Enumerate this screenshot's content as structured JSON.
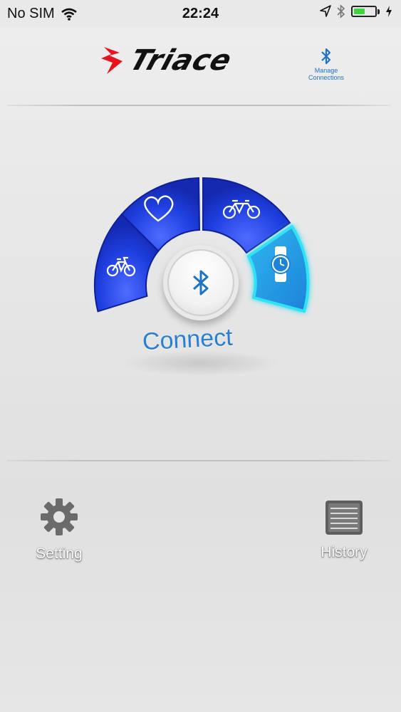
{
  "status_bar": {
    "carrier": "No SIM",
    "time": "22:24",
    "battery_level": 0.55,
    "battery_color": "#3fd43f"
  },
  "header": {
    "logo_text": "Triace",
    "manage_label": "Manage Connections",
    "accent_color": "#1e73c9"
  },
  "dial": {
    "connect_label": "Connect",
    "segments": [
      {
        "icon": "bicycle-icon"
      },
      {
        "icon": "heart-icon"
      },
      {
        "icon": "tandem-bicycle-icon"
      },
      {
        "icon": "watch-icon",
        "active": true
      }
    ],
    "segment_color": "#1f3fe0",
    "active_color": "#2fe3f5"
  },
  "bottom": {
    "setting_label": "Setting",
    "history_label": "History"
  }
}
